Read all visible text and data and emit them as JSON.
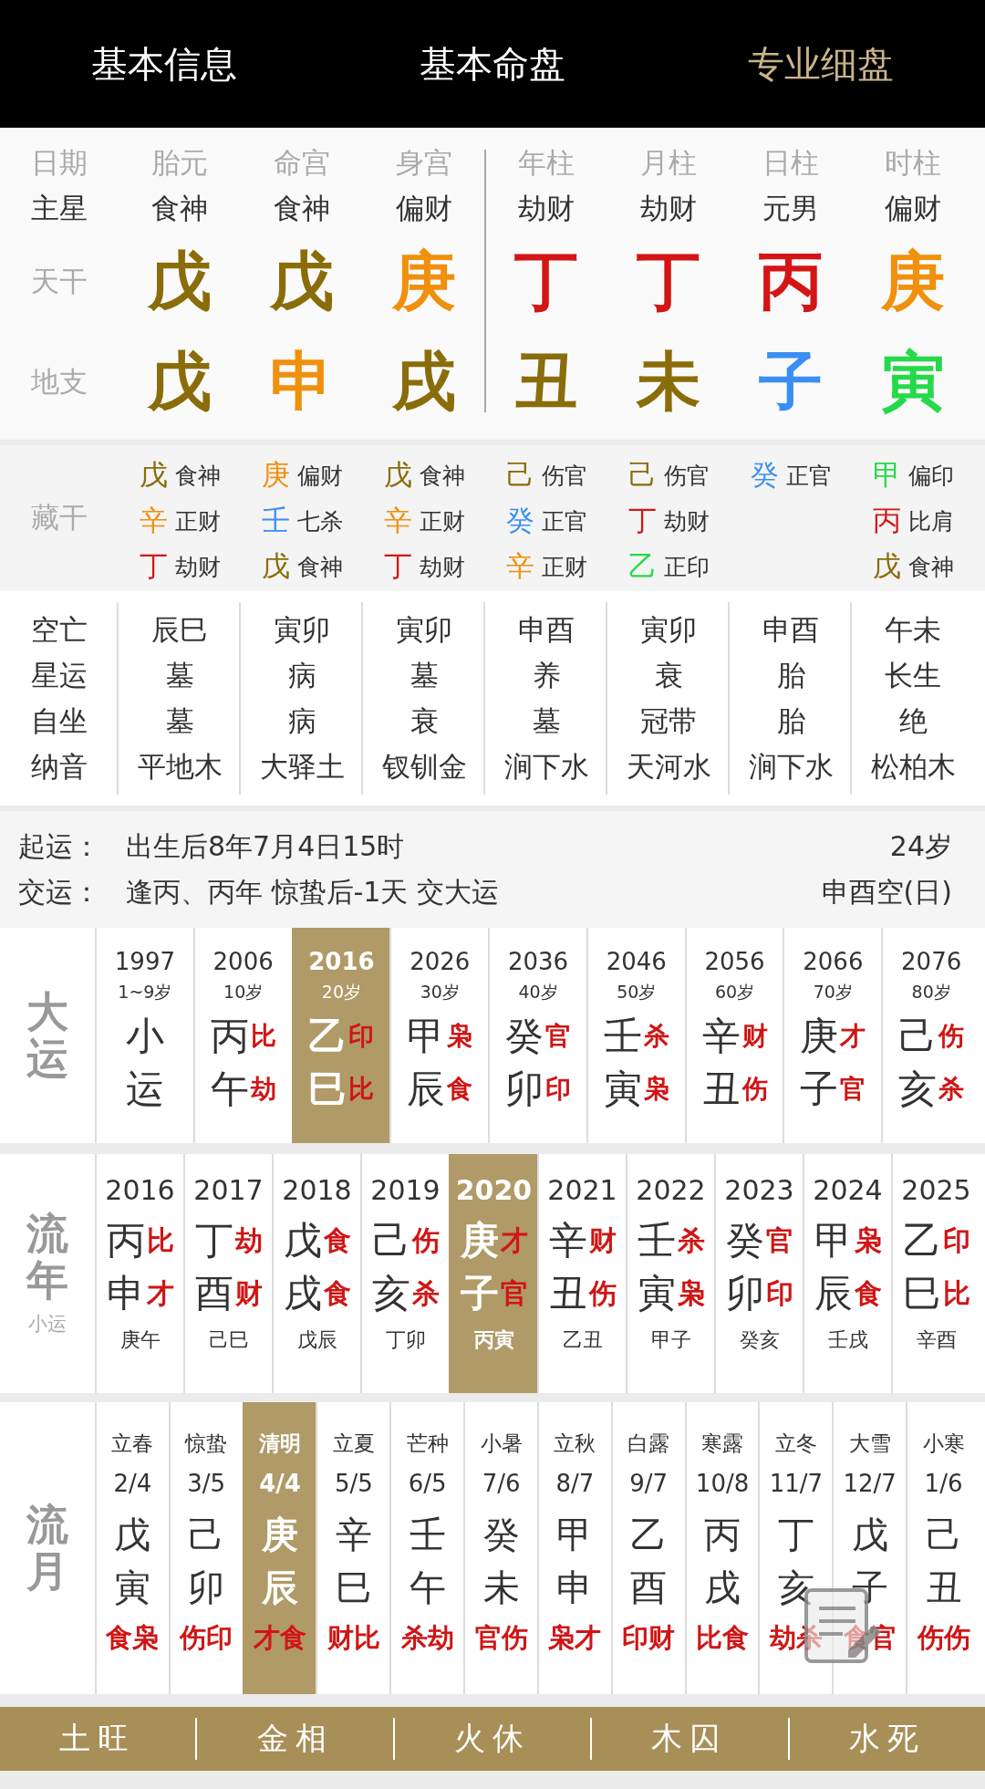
{
  "tabs": [
    {
      "label": "基本信息",
      "selected": false
    },
    {
      "label": "基本命盘",
      "selected": false
    },
    {
      "label": "专业细盘",
      "selected": true
    }
  ],
  "chart": {
    "row_labels": [
      "日期",
      "主星",
      "天干",
      "地支"
    ],
    "auxiliary": [
      {
        "title": "胎元",
        "star": "食神",
        "stem": {
          "char": "戊",
          "color": "#8a6d0a"
        },
        "branch": {
          "char": "戊",
          "color": "#8a6d0a"
        }
      },
      {
        "title": "命宫",
        "star": "食神",
        "stem": {
          "char": "戊",
          "color": "#8a6d0a"
        },
        "branch": {
          "char": "申",
          "color": "#f0900c"
        }
      },
      {
        "title": "身宫",
        "star": "偏财",
        "stem": {
          "char": "庚",
          "color": "#f0900c"
        },
        "branch": {
          "char": "戌",
          "color": "#8a6d0a"
        }
      }
    ],
    "pillars": [
      {
        "title": "年柱",
        "star": "劫财",
        "stem": {
          "char": "丁",
          "color": "#d41515"
        },
        "branch": {
          "char": "丑",
          "color": "#8a6d0a"
        }
      },
      {
        "title": "月柱",
        "star": "劫财",
        "stem": {
          "char": "丁",
          "color": "#d41515"
        },
        "branch": {
          "char": "未",
          "color": "#8a6d0a"
        }
      },
      {
        "title": "日柱",
        "star": "元男",
        "stem": {
          "char": "丙",
          "color": "#d41515"
        },
        "branch": {
          "char": "子",
          "color": "#3b8ef2"
        }
      },
      {
        "title": "时柱",
        "star": "偏财",
        "stem": {
          "char": "庚",
          "color": "#f0900c"
        },
        "branch": {
          "char": "寅",
          "color": "#26d94a"
        }
      }
    ]
  },
  "hidden_stems": {
    "label": "藏干",
    "columns": [
      [
        {
          "stem": "戊",
          "color": "#8a6d0a",
          "god": "食神"
        },
        {
          "stem": "辛",
          "color": "#f0900c",
          "god": "正财"
        },
        {
          "stem": "丁",
          "color": "#d41515",
          "god": "劫财"
        }
      ],
      [
        {
          "stem": "庚",
          "color": "#f0900c",
          "god": "偏财"
        },
        {
          "stem": "壬",
          "color": "#3b8ef2",
          "god": "七杀"
        },
        {
          "stem": "戊",
          "color": "#8a6d0a",
          "god": "食神"
        }
      ],
      [
        {
          "stem": "戊",
          "color": "#8a6d0a",
          "god": "食神"
        },
        {
          "stem": "辛",
          "color": "#f0900c",
          "god": "正财"
        },
        {
          "stem": "丁",
          "color": "#d41515",
          "god": "劫财"
        }
      ],
      [
        {
          "stem": "己",
          "color": "#8a6d0a",
          "god": "伤官"
        },
        {
          "stem": "癸",
          "color": "#3b8ef2",
          "god": "正官"
        },
        {
          "stem": "辛",
          "color": "#f0900c",
          "god": "正财"
        }
      ],
      [
        {
          "stem": "己",
          "color": "#8a6d0a",
          "god": "伤官"
        },
        {
          "stem": "丁",
          "color": "#d41515",
          "god": "劫财"
        },
        {
          "stem": "乙",
          "color": "#26d94a",
          "god": "正印"
        }
      ],
      [
        {
          "stem": "癸",
          "color": "#3b8ef2",
          "god": "正官"
        }
      ],
      [
        {
          "stem": "甲",
          "color": "#26d94a",
          "god": "偏印"
        },
        {
          "stem": "丙",
          "color": "#d41515",
          "god": "比肩"
        },
        {
          "stem": "戊",
          "color": "#8a6d0a",
          "god": "食神"
        }
      ]
    ]
  },
  "details": {
    "labels": [
      "空亡",
      "星运",
      "自坐",
      "纳音"
    ],
    "columns": [
      [
        "辰巳",
        "墓",
        "墓",
        "平地木"
      ],
      [
        "寅卯",
        "病",
        "病",
        "大驿土"
      ],
      [
        "寅卯",
        "墓",
        "衰",
        "钗钏金"
      ],
      [
        "申酉",
        "养",
        "墓",
        "涧下水"
      ],
      [
        "寅卯",
        "衰",
        "冠带",
        "天河水"
      ],
      [
        "申酉",
        "胎",
        "胎",
        "涧下水"
      ],
      [
        "午未",
        "长生",
        "绝",
        "松柏木"
      ]
    ]
  },
  "luck_info": [
    {
      "label": "起运：",
      "text": "出生后8年7月4日15时",
      "right": "24岁"
    },
    {
      "label": "交运：",
      "text": "逢丙、丙年 惊蛰后-1天 交大运",
      "right": "申酉空(日)"
    }
  ],
  "dayun": {
    "label": "大运",
    "items": [
      {
        "year": "1997",
        "age": "1~9岁",
        "stem": "小",
        "branch": "运",
        "selected": false
      },
      {
        "year": "2006",
        "age": "10岁",
        "stem": "丙",
        "stem_god": "比",
        "branch": "午",
        "branch_god": "劫",
        "selected": false
      },
      {
        "year": "2016",
        "age": "20岁",
        "stem": "乙",
        "stem_god": "印",
        "branch": "巳",
        "branch_god": "比",
        "selected": true
      },
      {
        "year": "2026",
        "age": "30岁",
        "stem": "甲",
        "stem_god": "枭",
        "branch": "辰",
        "branch_god": "食",
        "selected": false
      },
      {
        "year": "2036",
        "age": "40岁",
        "stem": "癸",
        "stem_god": "官",
        "branch": "卯",
        "branch_god": "印",
        "selected": false
      },
      {
        "year": "2046",
        "age": "50岁",
        "stem": "壬",
        "stem_god": "杀",
        "branch": "寅",
        "branch_god": "枭",
        "selected": false
      },
      {
        "year": "2056",
        "age": "60岁",
        "stem": "辛",
        "stem_god": "财",
        "branch": "丑",
        "branch_god": "伤",
        "selected": false
      },
      {
        "year": "2066",
        "age": "70岁",
        "stem": "庚",
        "stem_god": "才",
        "branch": "子",
        "branch_god": "官",
        "selected": false
      },
      {
        "year": "2076",
        "age": "80岁",
        "stem": "己",
        "stem_god": "伤",
        "branch": "亥",
        "branch_god": "杀",
        "selected": false
      }
    ]
  },
  "liunian": {
    "label": "流年",
    "sublabel": "小运",
    "items": [
      {
        "year": "2016",
        "stem": "丙",
        "stem_god": "比",
        "branch": "申",
        "branch_god": "才",
        "minor": "庚午",
        "selected": false
      },
      {
        "year": "2017",
        "stem": "丁",
        "stem_god": "劫",
        "branch": "酉",
        "branch_god": "财",
        "minor": "己巳",
        "selected": false
      },
      {
        "year": "2018",
        "stem": "戊",
        "stem_god": "食",
        "branch": "戌",
        "branch_god": "食",
        "minor": "戊辰",
        "selected": false
      },
      {
        "year": "2019",
        "stem": "己",
        "stem_god": "伤",
        "branch": "亥",
        "branch_god": "杀",
        "minor": "丁卯",
        "selected": false
      },
      {
        "year": "2020",
        "stem": "庚",
        "stem_god": "才",
        "branch": "子",
        "branch_god": "官",
        "minor": "丙寅",
        "selected": true
      },
      {
        "year": "2021",
        "stem": "辛",
        "stem_god": "财",
        "branch": "丑",
        "branch_god": "伤",
        "minor": "乙丑",
        "selected": false
      },
      {
        "year": "2022",
        "stem": "壬",
        "stem_god": "杀",
        "branch": "寅",
        "branch_god": "枭",
        "minor": "甲子",
        "selected": false
      },
      {
        "year": "2023",
        "stem": "癸",
        "stem_god": "官",
        "branch": "卯",
        "branch_god": "印",
        "minor": "癸亥",
        "selected": false
      },
      {
        "year": "2024",
        "stem": "甲",
        "stem_god": "枭",
        "branch": "辰",
        "branch_god": "食",
        "minor": "壬戌",
        "selected": false
      },
      {
        "year": "2025",
        "stem": "乙",
        "stem_god": "印",
        "branch": "巳",
        "branch_god": "比",
        "minor": "辛酉",
        "selected": false
      }
    ]
  },
  "liuyue": {
    "label": "流月",
    "items": [
      {
        "term": "立春",
        "date": "2/4",
        "stem": "戊",
        "branch": "寅",
        "gods": "食枭",
        "selected": false
      },
      {
        "term": "惊蛰",
        "date": "3/5",
        "stem": "己",
        "branch": "卯",
        "gods": "伤印",
        "selected": false
      },
      {
        "term": "清明",
        "date": "4/4",
        "stem": "庚",
        "branch": "辰",
        "gods": "才食",
        "selected": true
      },
      {
        "term": "立夏",
        "date": "5/5",
        "stem": "辛",
        "branch": "巳",
        "gods": "财比",
        "selected": false
      },
      {
        "term": "芒种",
        "date": "6/5",
        "stem": "壬",
        "branch": "午",
        "gods": "杀劫",
        "selected": false
      },
      {
        "term": "小暑",
        "date": "7/6",
        "stem": "癸",
        "branch": "未",
        "gods": "官伤",
        "selected": false
      },
      {
        "term": "立秋",
        "date": "8/7",
        "stem": "甲",
        "branch": "申",
        "gods": "枭才",
        "selected": false
      },
      {
        "term": "白露",
        "date": "9/7",
        "stem": "乙",
        "branch": "酉",
        "gods": "印财",
        "selected": false
      },
      {
        "term": "寒露",
        "date": "10/8",
        "stem": "丙",
        "branch": "戌",
        "gods": "比食",
        "selected": false
      },
      {
        "term": "立冬",
        "date": "11/7",
        "stem": "丁",
        "branch": "亥",
        "gods": "劫杀",
        "selected": false
      },
      {
        "term": "大雪",
        "date": "12/7",
        "stem": "戊",
        "branch": "子",
        "gods": "食官",
        "selected": false
      },
      {
        "term": "小寒",
        "date": "1/6",
        "stem": "己",
        "branch": "丑",
        "gods": "伤伤",
        "selected": false
      }
    ]
  },
  "footer": [
    "土旺",
    "金相",
    "火休",
    "木囚",
    "水死"
  ]
}
